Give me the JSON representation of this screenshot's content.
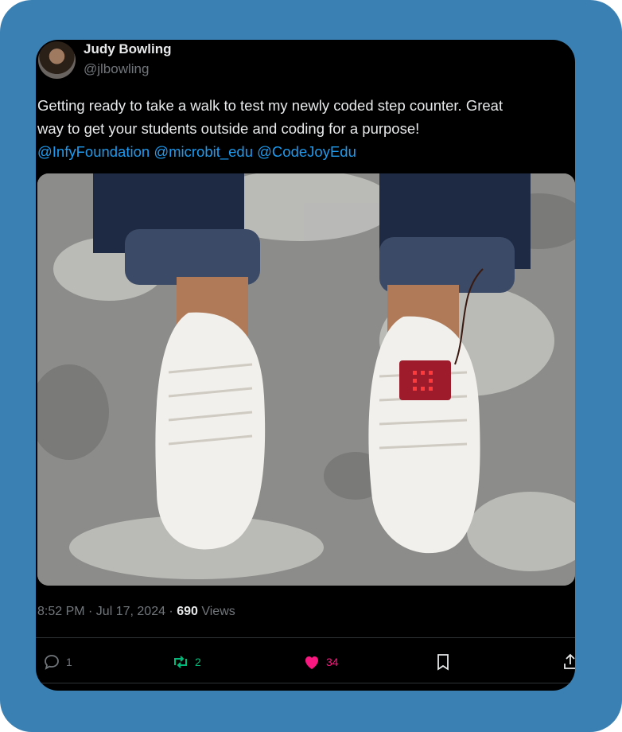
{
  "tweet": {
    "author_name": "Judy Bowling",
    "author_handle": "@jlbowling",
    "text_line1": "Getting ready to take a walk to test my newly coded step counter. Great",
    "text_line2": "way to get your students outside and coding for a purpose!",
    "mentions": [
      "@InfyFoundation",
      "@microbit_edu",
      "@CodeJoyEdu"
    ],
    "time": "8:52 PM · Jul 17, 2024 · ",
    "views_count": "690",
    "views_label": " Views",
    "replies": "1",
    "reposts": "2",
    "likes": "34"
  },
  "colors": {
    "frame": "#3a80b3",
    "card": "#000000",
    "mention": "#1d9bf0",
    "repost": "#00ba7c",
    "like": "#f91880"
  },
  "icons": [
    "reply-icon",
    "repost-icon",
    "heart-icon",
    "bookmark-icon",
    "share-icon"
  ]
}
